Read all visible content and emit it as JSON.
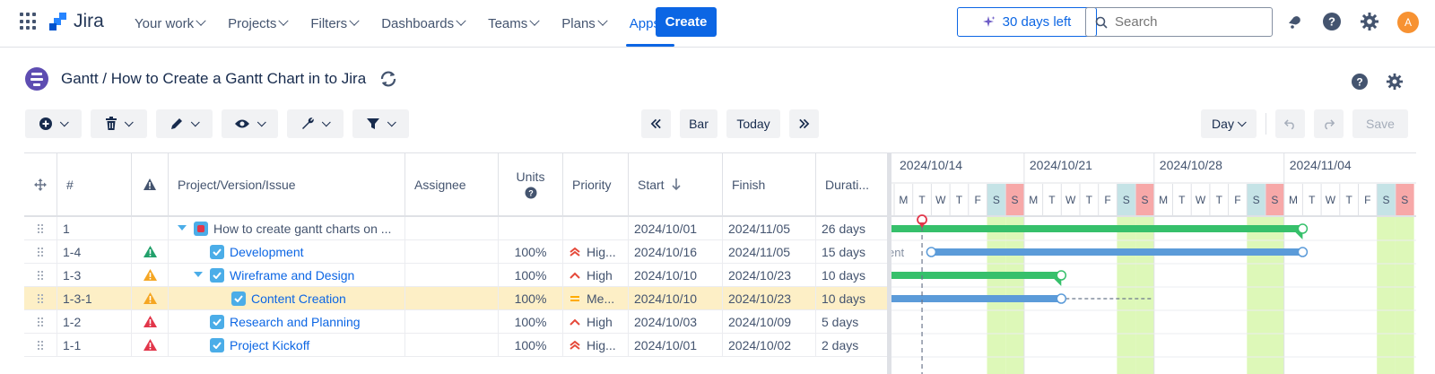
{
  "nav": {
    "product": "Jira",
    "items": [
      {
        "label": "Your work",
        "active": false
      },
      {
        "label": "Projects",
        "active": false
      },
      {
        "label": "Filters",
        "active": false
      },
      {
        "label": "Dashboards",
        "active": false
      },
      {
        "label": "Teams",
        "active": false
      },
      {
        "label": "Plans",
        "active": false
      },
      {
        "label": "Apps",
        "active": true
      }
    ],
    "create_label": "Create",
    "trial_label": "30 days left",
    "search_placeholder": "Search",
    "avatar_initial": "A",
    "accent": "#0c66e4"
  },
  "page": {
    "title": "Gantt / How to Create a Gantt Chart in to Jira"
  },
  "toolbar": {
    "bar_label": "Bar",
    "today_label": "Today",
    "day_label": "Day",
    "save_label": "Save"
  },
  "table": {
    "columns": {
      "num": "#",
      "name": "Project/Version/Issue",
      "assignee": "Assignee",
      "units": "Units",
      "priority": "Priority",
      "start": "Start",
      "finish": "Finish",
      "duration": "Durati..."
    },
    "rows": [
      {
        "num": "1",
        "name": "How to create gantt charts on ...",
        "type": "project",
        "indent": 0,
        "expanded": true,
        "units": "",
        "priority": "",
        "priority_level": "",
        "start": "2024/10/01",
        "finish": "2024/11/05",
        "duration": "26 days",
        "warning": ""
      },
      {
        "num": "1-4",
        "name": "Development",
        "type": "task",
        "indent": 1,
        "units": "100%",
        "priority": "Hig...",
        "priority_level": "highest",
        "start": "2024/10/16",
        "finish": "2024/11/05",
        "duration": "15 days",
        "warning": "green"
      },
      {
        "num": "1-3",
        "name": "Wireframe and Design",
        "type": "task",
        "indent": 1,
        "expanded": true,
        "units": "100%",
        "priority": "High",
        "priority_level": "high",
        "start": "2024/10/10",
        "finish": "2024/10/23",
        "duration": "10 days",
        "warning": "orange"
      },
      {
        "num": "1-3-1",
        "name": "Content Creation",
        "type": "task",
        "indent": 2,
        "units": "100%",
        "priority": "Me...",
        "priority_level": "medium",
        "start": "2024/10/10",
        "finish": "2024/10/23",
        "duration": "10 days",
        "warning": "orange",
        "selected": true
      },
      {
        "num": "1-2",
        "name": "Research and Planning",
        "type": "task",
        "indent": 1,
        "units": "100%",
        "priority": "High",
        "priority_level": "high",
        "start": "2024/10/03",
        "finish": "2024/10/09",
        "duration": "5 days",
        "warning": "red"
      },
      {
        "num": "1-1",
        "name": "Project Kickoff",
        "type": "task",
        "indent": 1,
        "units": "100%",
        "priority": "Hig...",
        "priority_level": "highest",
        "start": "2024/10/01",
        "finish": "2024/10/02",
        "duration": "2 days",
        "warning": "red"
      }
    ]
  },
  "gantt": {
    "weeks": [
      "2024/10/14",
      "2024/10/21",
      "2024/10/28",
      "2024/11/04"
    ],
    "day_letters": [
      "M",
      "T",
      "W",
      "T",
      "F",
      "S",
      "S",
      "M",
      "T",
      "W",
      "T",
      "F",
      "S",
      "S",
      "M",
      "T",
      "W",
      "T",
      "F",
      "S",
      "S",
      "M",
      "T",
      "W",
      "T",
      "F",
      "S",
      "S"
    ],
    "clipped_label": "ent",
    "colors": {
      "project_bar": "#36c06b",
      "task_bar": "#5b9bd9",
      "weekend": "#ddf8b8",
      "saturday": "#c5e3e6",
      "sunday": "#f7a8a8",
      "today": "#e2364a"
    }
  }
}
